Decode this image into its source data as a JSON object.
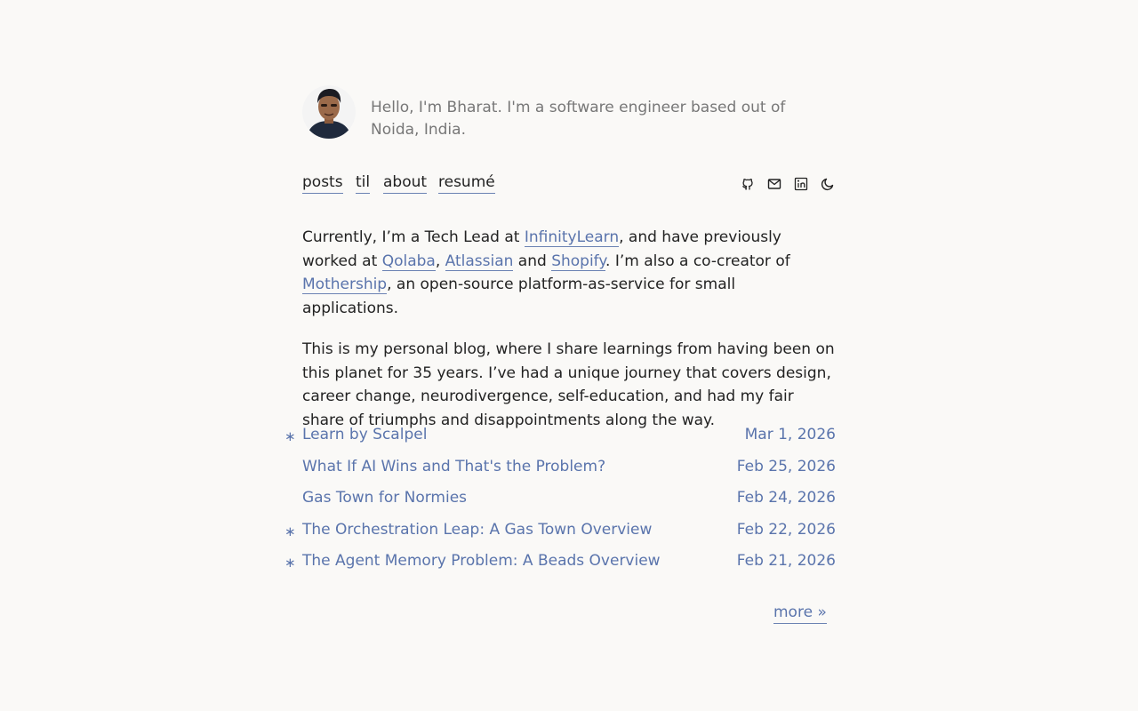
{
  "header": {
    "intro": "Hello, I'm Bharat. I'm a software engineer based out of Noida, India."
  },
  "nav": {
    "links": [
      {
        "label": "posts"
      },
      {
        "label": "til"
      },
      {
        "label": "about"
      },
      {
        "label": "resumé"
      }
    ],
    "icons": [
      "github-icon",
      "mail-icon",
      "linkedin-icon",
      "moon-icon"
    ]
  },
  "bio": {
    "p1": {
      "t1": "Currently, I’m a Tech Lead at ",
      "link1": "InfinityLearn",
      "t2": ", and have previously worked at ",
      "link2": "Qolaba",
      "t3": ", ",
      "link3": "Atlassian",
      "t4": " and ",
      "link4": "Shopify",
      "t5": ". I’m also a co-creator of ",
      "link5": "Mothership",
      "t6": ", an open-source platform-as-service for small applications."
    },
    "p2": "This is my personal blog, where I share learnings from having been on this planet for 35 years. I’ve had a unique journey that covers design, career change, neurodivergence, self-education, and had my fair share of triumphs and disappointments along the way."
  },
  "posts": [
    {
      "title": "Learn by Scalpel",
      "date": "Mar 1, 2026",
      "star": "∗"
    },
    {
      "title": "What If AI Wins and That's the Problem?",
      "date": "Feb 25, 2026",
      "star": ""
    },
    {
      "title": "Gas Town for Normies",
      "date": "Feb 24, 2026",
      "star": ""
    },
    {
      "title": "The Orchestration Leap: A Gas Town Overview",
      "date": "Feb 22, 2026",
      "star": "∗"
    },
    {
      "title": "The Agent Memory Problem: A Beads Overview",
      "date": "Feb 21, 2026",
      "star": "∗"
    }
  ],
  "more_label": "more »",
  "colors": {
    "background": "#faf9f7",
    "link": "#5a74ac",
    "text": "#222222",
    "muted": "#777777"
  }
}
